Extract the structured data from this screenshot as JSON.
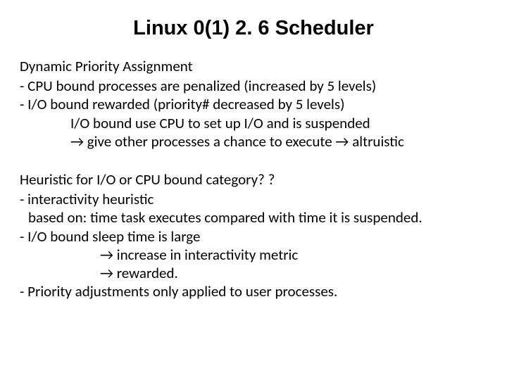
{
  "title": "Linux 0(1) 2. 6 Scheduler",
  "section1": {
    "heading": "Dynamic Priority Assignment",
    "line1": "-  CPU bound processes are penalized (increased by 5 levels)",
    "line2": "-  I/O bound rewarded (priority# decreased by 5 levels)",
    "line3": "I/O bound use CPU to set up I/O and is suspended",
    "line4": "→ give other processes a chance to execute → altruistic"
  },
  "section2": {
    "heading": "Heuristic for I/O or CPU bound category? ?",
    "line1": "- interactivity heuristic",
    "line2": "based on: time task executes compared with time it is suspended.",
    "line3": "- I/O bound  sleep time is large",
    "line4": "→ increase in interactivity metric",
    "line5": "→ rewarded.",
    "line6": "- Priority adjustments only applied to user processes."
  }
}
